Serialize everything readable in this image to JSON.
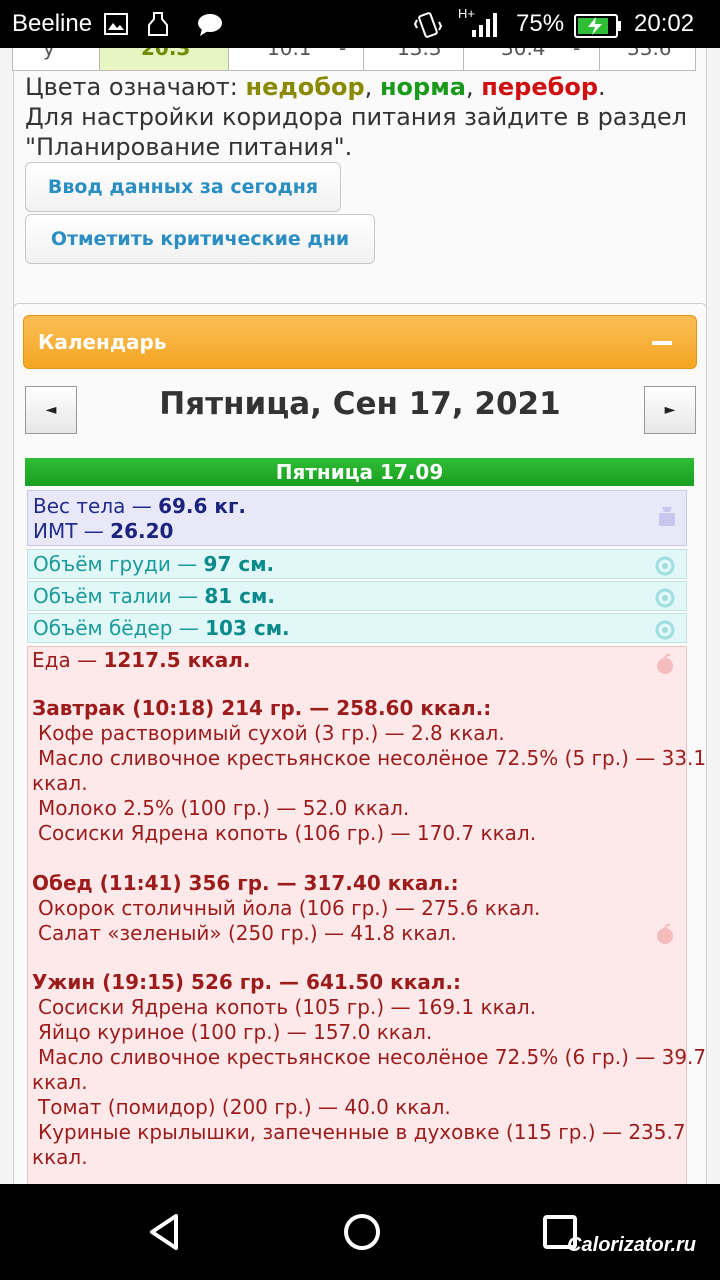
{
  "status_bar": {
    "carrier": "Beeline",
    "network": "H+",
    "battery": "75%",
    "time": "20:02"
  },
  "top_table": {
    "label": "у",
    "value": "20.3",
    "range1_from": "10.1",
    "range1_sep": "-",
    "range1_to": "13.3",
    "range2_from": "30.4",
    "range2_sep": "-",
    "range2_to": "33.6"
  },
  "legend": {
    "prefix": "Цвета означают:",
    "under": "недобор",
    "comma1": ",",
    "norm": "норма",
    "comma2": ",",
    "over": "перебор",
    "dot": ".",
    "line2": "Для настройки коридора питания зайдите в раздел",
    "line3": "\"Планирование питания\"."
  },
  "buttons": {
    "enter_data": "Ввод данных за сегодня",
    "critical_days": "Отметить критические дни"
  },
  "calendar": {
    "title": "Календарь",
    "prev": "◄",
    "next": "►",
    "date": "Пятница, Сен 17, 2021",
    "day_header": "Пятница 17.09",
    "weight_label": "Вес тела —",
    "weight_value": "69.6 кг.",
    "bmi_label": "ИМТ —",
    "bmi_value": "26.20",
    "chest_label": "Объём груди —",
    "chest_value": "97 см.",
    "waist_label": "Объём талии —",
    "waist_value": "81 см.",
    "hips_label": "Объём бёдер —",
    "hips_value": "103 см.",
    "food_label": "Еда —",
    "food_value": "1217.5 ккал.",
    "breakfast": {
      "title": "Завтрак (10:18) 214 гр. — 258.60 ккал.:",
      "items": [
        "Кофе растворимый сухой (3 гр.) — 2.8 ккал.",
        "Масло сливочное крестьянское несолёное 72.5% (5 гр.) — 33.1",
        "ккал.",
        "Молоко 2.5% (100 гр.) — 52.0 ккал.",
        "Сосиски Ядрена копоть (106 гр.) — 170.7 ккал."
      ]
    },
    "lunch": {
      "title": "Обед (11:41) 356 гр. — 317.40 ккал.:",
      "items": [
        "Окорок столичный йола (106 гр.) — 275.6 ккал.",
        "Салат «зеленый» (250 гр.) — 41.8 ккал."
      ]
    },
    "dinner": {
      "title": "Ужин (19:15) 526 гр. — 641.50 ккал.:",
      "items": [
        "Сосиски Ядрена копоть (105 гр.) — 169.1 ккал.",
        "Яйцо куриное (100 гр.) — 157.0 ккал.",
        "Масло сливочное крестьянское несолёное 72.5% (6 гр.) — 39.7",
        "ккал.",
        "Томат (помидор) (200 гр.) — 40.0 ккал.",
        "Куриные крылышки, запеченные в духовке (115 гр.) — 235.7",
        "ккал."
      ]
    }
  },
  "watermark": "Calorizator.ru",
  "colors": {
    "accent_orange": "#f5a623",
    "day_green": "#1a9e21",
    "under": "#8a8a00",
    "norm": "#1a9a1a",
    "over": "#d01010"
  }
}
